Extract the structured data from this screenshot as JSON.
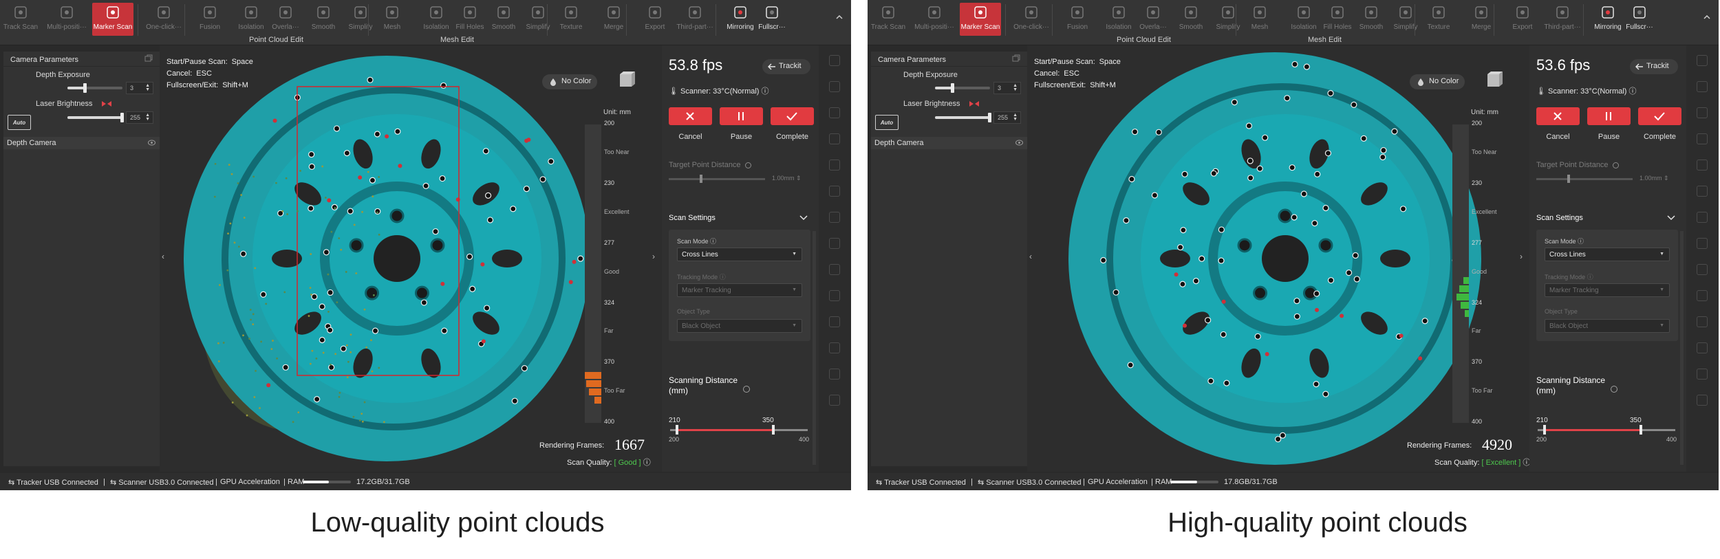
{
  "toolbar": {
    "tools": [
      {
        "label": "Track Scan",
        "icon": "track-scan-icon"
      },
      {
        "label": "Multi-positi···",
        "icon": "multi-position-icon"
      },
      {
        "label": "Marker Scan",
        "icon": "marker-scan-icon"
      },
      {
        "label": "One-click···",
        "icon": "one-click-icon"
      },
      {
        "label": "Fusion",
        "icon": "fusion-icon"
      },
      {
        "label": "Isolation",
        "icon": "isolation-icon"
      },
      {
        "label": "Overla···",
        "icon": "overlap-icon"
      },
      {
        "label": "Smooth",
        "icon": "smooth-icon"
      },
      {
        "label": "Simplify",
        "icon": "simplify-icon"
      },
      {
        "label": "Mesh",
        "icon": "mesh-icon"
      },
      {
        "label": "Isolation",
        "icon": "mesh-isolation-icon"
      },
      {
        "label": "Fill Holes",
        "icon": "fill-holes-icon"
      },
      {
        "label": "Smooth",
        "icon": "mesh-smooth-icon"
      },
      {
        "label": "Simplify",
        "icon": "mesh-simplify-icon"
      },
      {
        "label": "Texture",
        "icon": "texture-icon"
      },
      {
        "label": "Merge",
        "icon": "merge-icon"
      },
      {
        "label": "Export",
        "icon": "export-icon"
      },
      {
        "label": "Third-part···",
        "icon": "third-party-icon"
      },
      {
        "label": "Mirroring",
        "icon": "mirroring-icon"
      },
      {
        "label": "Fullscr···",
        "icon": "fullscreen-icon"
      }
    ],
    "groups": {
      "point_cloud_edit": "Point Cloud Edit",
      "mesh_edit": "Mesh Edit"
    }
  },
  "left_panel": {
    "title": "Camera Parameters",
    "depth_exposure_label": "Depth Exposure",
    "depth_exposure_value": "3",
    "depth_exposure_level": 0.33,
    "laser_brightness_label": "Laser Brightness",
    "laser_brightness_value": "255",
    "laser_brightness_level": 1.0,
    "auto_label": "Auto",
    "depth_camera_label": "Depth Camera"
  },
  "shortcuts": [
    {
      "label": "Start/Pause Scan:",
      "key": "Space"
    },
    {
      "label": "Cancel:",
      "key": "ESC"
    },
    {
      "label": "Fullscreen/Exit:",
      "key": "Shift+M"
    }
  ],
  "viewport": {
    "no_color": "No Color",
    "cube_label": "FRONT",
    "unit": "Unit: mm",
    "ticks": [
      "200",
      "Too Near",
      "230",
      "Excellent",
      "277",
      "Good",
      "324",
      "Far",
      "370",
      "Too Far",
      "400"
    ],
    "rendering_frames_label": "Rendering Frames:",
    "scan_quality_label": "Scan Quality:"
  },
  "right_panel": {
    "trackit": "Trackit",
    "scanner_temp": "Scanner: 33°C(Normal)",
    "cancel": "Cancel",
    "pause": "Pause",
    "complete": "Complete",
    "target_point_distance": "Target Point Distance",
    "target_point_value": "1.00mm",
    "scan_settings": "Scan Settings",
    "scan_mode_label": "Scan Mode",
    "scan_mode_value": "Cross Lines",
    "tracking_mode_label": "Tracking Mode",
    "tracking_mode_value": "Marker Tracking",
    "object_type_label": "Object Type",
    "object_type_value": "Black Object",
    "scanning_distance_title": "Scanning Distance",
    "scanning_distance_unit": "(mm)",
    "range_low": "210",
    "range_high": "350",
    "range_min": "200",
    "range_max": "400",
    "range_low_value": 210,
    "range_high_value": 350,
    "range_min_value": 200,
    "range_max_value": 400
  },
  "status": {
    "tracker": "Tracker USB Connected",
    "scanner": "Scanner USB3.0 Connected",
    "gpu": "GPU Acceleration",
    "ram": "RAM"
  },
  "panels": [
    {
      "fps": "53.8 fps",
      "rendering_frames": "1667",
      "scan_quality": "[ Good ]",
      "quality_color": "#4ec84e",
      "ram_value": "17.2GB/31.7GB",
      "ram_fraction": 0.54,
      "caption": "Low-quality point clouds"
    },
    {
      "fps": "53.6 fps",
      "rendering_frames": "4920",
      "scan_quality": "[ Excellent ]",
      "quality_color": "#4ec84e",
      "ram_value": "17.8GB/31.7GB",
      "ram_fraction": 0.56,
      "caption": "High-quality point clouds"
    }
  ],
  "colors": {
    "accent_red": "#e13b40",
    "point_cloud": "#1f9fa8",
    "good_green": "#4ec84e"
  }
}
